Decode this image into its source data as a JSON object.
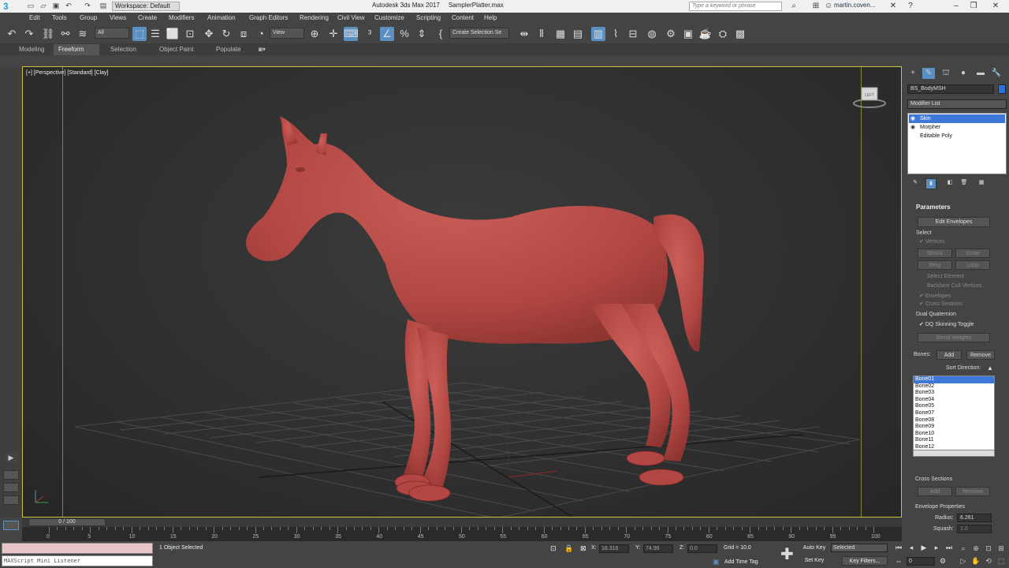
{
  "titlebar": {
    "workspace": "Workspace: Default",
    "title": "Autodesk 3ds Max 2017",
    "file": "SamplerPlatter.max",
    "search_placeholder": "Type a keyword or phrase",
    "user": "martin.coven..."
  },
  "menu": [
    "Edit",
    "Tools",
    "Group",
    "Views",
    "Create",
    "Modifiers",
    "Animation",
    "Graph Editors",
    "Rendering",
    "Civil View",
    "Customize",
    "Scripting",
    "Content",
    "Help"
  ],
  "toolbar": {
    "filter": "All",
    "refcoord": "View",
    "selection_set": "Create Selection Se"
  },
  "ribbon_tabs": [
    "Modeling",
    "Freeform",
    "Selection",
    "Object Paint",
    "Populate"
  ],
  "ribbon_active": "Freeform",
  "viewport": {
    "label": "[+] [Perspective] [Standard] [Clay]",
    "viewcube_label": "LEFT"
  },
  "command_panel": {
    "object_name": "BS_BodyMSH",
    "modifier_list": "Modifier List",
    "stack": [
      "Skin",
      "Morpher",
      "Editable Poly"
    ],
    "parameters_title": "Parameters",
    "edit_envelopes": "Edit Envelopes",
    "select_label": "Select",
    "vertices": "Vertices",
    "shrink": "Shrink",
    "grow": "Grow",
    "ring": "Ring",
    "loop": "Loop",
    "select_element": "Select Element",
    "backface_cull": "Backface Cull Vertices",
    "envelopes": "Envelopes",
    "cross_sections_cb": "Cross Sections",
    "dual_quaternion": "Dual Quaternion",
    "dq_toggle": "DQ Skinning Toggle",
    "blend_weights": "Blend Weights",
    "bones_label": "Bones:",
    "add": "Add",
    "remove": "Remove",
    "sort_direction": "Sort Direction:",
    "bones": [
      "Bone01",
      "Bone02",
      "Bone03",
      "Bone04",
      "Bone05",
      "Bone07",
      "Bone08",
      "Bone09",
      "Bone10",
      "Bone11",
      "Bone12"
    ],
    "cross_sections": "Cross Sections",
    "cs_add": "Add",
    "cs_remove": "Remove",
    "envelope_properties": "Envelope Properties",
    "radius_label": "Radius:",
    "radius_value": "6.261",
    "squash_label": "Squash:",
    "squash_value": "1.0"
  },
  "timeline": {
    "frame": "0 / 100",
    "ticks": [
      "0",
      "5",
      "10",
      "15",
      "20",
      "25",
      "30",
      "35",
      "40",
      "45",
      "50",
      "55",
      "60",
      "65",
      "70",
      "75",
      "80",
      "85",
      "90",
      "95",
      "100"
    ]
  },
  "status": {
    "listener_label": "MAXScript Mini Listener",
    "selected": "1 Object Selected",
    "x_label": "X:",
    "x_value": "16.316",
    "y_label": "Y:",
    "y_value": "74.96",
    "z_label": "Z:",
    "z_value": "0.0",
    "grid": "Grid = 10.0",
    "add_time_tag": "Add Time Tag",
    "auto_key": "Auto Key",
    "auto_key_dropdown": "Selected",
    "set_key": "Set Key",
    "key_filters": "Key Filters...",
    "current_frame": "0"
  },
  "colors": {
    "accent": "#5a8fc2",
    "horse": "#b84a47",
    "safe_frame": "#c9c040"
  }
}
